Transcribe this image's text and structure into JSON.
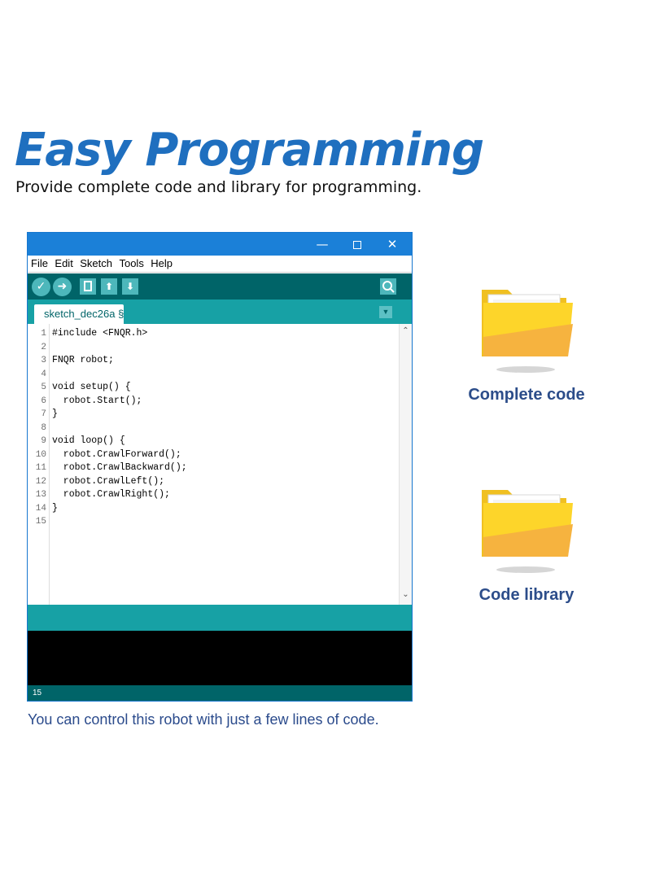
{
  "header": {
    "title": "Easy Programming",
    "subtitle": "Provide complete code and library for programming."
  },
  "ide": {
    "window_controls": {
      "minimize": "—",
      "close": "✕"
    },
    "menu": [
      "File",
      "Edit",
      "Sketch",
      "Tools",
      "Help"
    ],
    "toolbar": {
      "verify_icon": "check-icon",
      "upload_icon": "arrow-right-icon",
      "new_icon": "new-file-icon",
      "open_icon": "arrow-up-icon",
      "save_icon": "arrow-down-icon",
      "serial_icon": "magnifier-icon"
    },
    "tab": {
      "name": "sketch_dec26a §"
    },
    "code": [
      {
        "n": "1",
        "text": "#include <FNQR.h>"
      },
      {
        "n": "2",
        "text": ""
      },
      {
        "n": "3",
        "text": "FNQR robot;"
      },
      {
        "n": "4",
        "text": ""
      },
      {
        "n": "5",
        "text": "void setup() {"
      },
      {
        "n": "6",
        "text": "  robot.Start();"
      },
      {
        "n": "7",
        "text": "}"
      },
      {
        "n": "8",
        "text": ""
      },
      {
        "n": "9",
        "text": "void loop() {"
      },
      {
        "n": "10",
        "text": "  robot.CrawlForward();"
      },
      {
        "n": "11",
        "text": "  robot.CrawlBackward();"
      },
      {
        "n": "12",
        "text": "  robot.CrawlLeft();"
      },
      {
        "n": "13",
        "text": "  robot.CrawlRight();"
      },
      {
        "n": "14",
        "text": "}"
      },
      {
        "n": "15",
        "text": ""
      }
    ],
    "status_line": "15",
    "colors": {
      "titlebar": "#1b80d8",
      "toolbar": "#006468",
      "tabbar": "#17a1a5",
      "console": "#000000"
    }
  },
  "features": [
    {
      "label": "Complete code",
      "icon": "folder-icon"
    },
    {
      "label": "Code library",
      "icon": "folder-icon"
    }
  ],
  "caption": "You can control this robot with just a few lines of code."
}
